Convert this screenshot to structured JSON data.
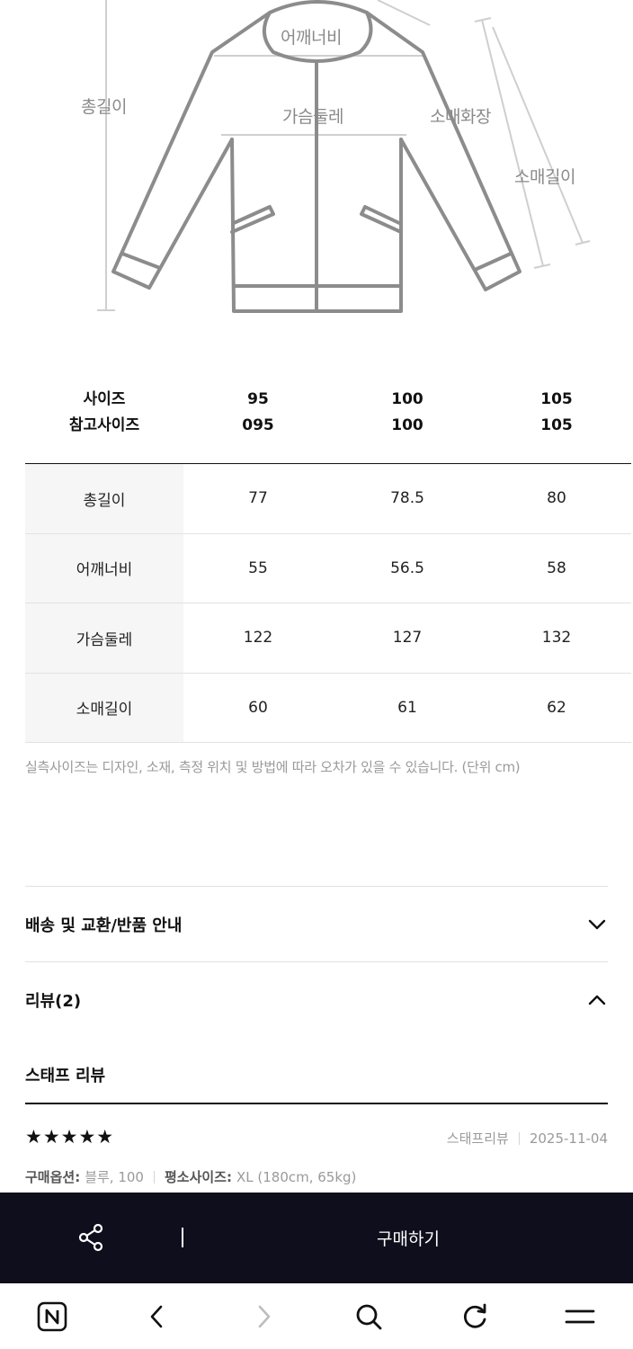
{
  "diagram": {
    "labels": {
      "total_length": "총길이",
      "shoulder_width": "어깨너비",
      "chest": "가슴둘레",
      "sleeve_reach": "소매화장",
      "sleeve_length": "소매길이"
    }
  },
  "size_table": {
    "header_row1": [
      "사이즈",
      "95",
      "100",
      "105"
    ],
    "header_row2": [
      "참고사이즈",
      "095",
      "100",
      "105"
    ],
    "rows": [
      {
        "label": "총길이",
        "values": [
          "77",
          "78.5",
          "80"
        ]
      },
      {
        "label": "어깨너비",
        "values": [
          "55",
          "56.5",
          "58"
        ]
      },
      {
        "label": "가슴둘레",
        "values": [
          "122",
          "127",
          "132"
        ]
      },
      {
        "label": "소매길이",
        "values": [
          "60",
          "61",
          "62"
        ]
      }
    ],
    "note": "실측사이즈는 디자인, 소재, 측정 위치 및 방법에 따라 오차가 있을 수 있습니다. (단위 cm)"
  },
  "accordions": {
    "shipping": "배송 및 교환/반품 안내",
    "reviews": "리뷰(2)"
  },
  "staff_review": {
    "title": "스태프 리뷰",
    "stars": "★★★★★",
    "author": "스태프리뷰",
    "date": "2025-11-04",
    "option_label": "구매옵션:",
    "option_value": "블루, 100",
    "size_label": "평소사이즈:",
    "size_value": "XL (180cm, 65kg)"
  },
  "buy_bar": {
    "buy_label": "구매하기"
  },
  "icons": {
    "share": "share-icon",
    "home": "naver-n-icon",
    "back": "chevron-left-icon",
    "forward": "chevron-right-icon",
    "search": "search-icon",
    "reload": "reload-icon",
    "menu": "menu-icon"
  },
  "colors": {
    "buy_bar_bg": "#0f0e1c",
    "label_bg": "#f6f6f6"
  }
}
